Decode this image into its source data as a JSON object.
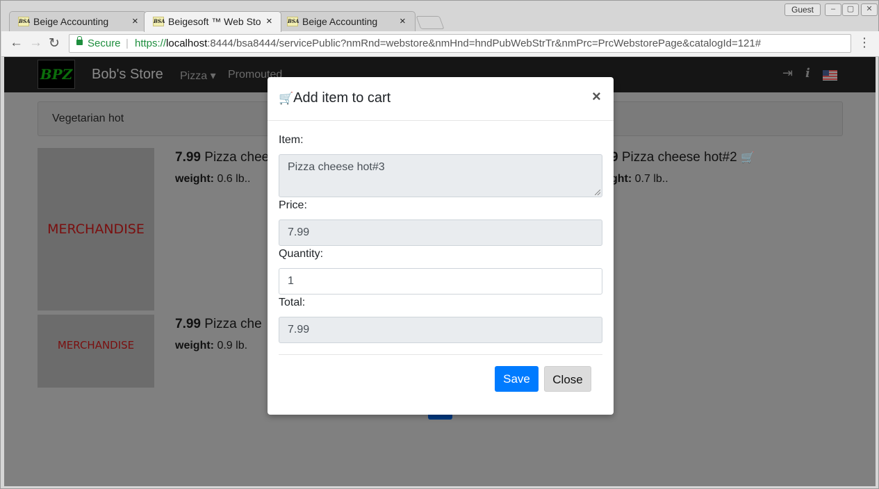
{
  "browser": {
    "tabs": [
      {
        "title": "Beige Accounting",
        "favicon": "BSA",
        "active": false
      },
      {
        "title": "Beigesoft ™ Web Sto",
        "favicon": "BSA",
        "active": true
      },
      {
        "title": "Beige Accounting",
        "favicon": "BSA",
        "active": false
      }
    ],
    "close_glyph": "×",
    "profile": "Guest",
    "window_controls": {
      "minimize": "–",
      "restore": "▢",
      "close": "✕"
    },
    "nav": {
      "back": "←",
      "forward": "→",
      "reload": "↻"
    },
    "address": {
      "secure_label": "Secure",
      "scheme": "https://",
      "host": "localhost",
      "rest": ":8444/bsa8444/servicePublic?nmRnd=webstore&nmHnd=hndPubWebStrTr&nmPrc=PrcWebstorePage&catalogId=121#"
    },
    "menu_glyph": "⋮"
  },
  "site": {
    "logo_text": "BPZ",
    "brand": "Bob's Store",
    "nav_items": [
      {
        "label": "Pizza ▾"
      },
      {
        "label": "Promouted"
      }
    ],
    "icons": {
      "login": "⇥",
      "info": "i"
    },
    "breadcrumb": "Vegetarian hot",
    "products": [
      {
        "price": "7.99",
        "name": "Pizza chee",
        "weight_label": "weight:",
        "weight": "0.6 lb..",
        "image_text": "MERCHANDISE"
      },
      {
        "price": "9",
        "name": "Pizza cheese hot#2",
        "weight_label": "ght:",
        "weight": "0.7 lb..",
        "cart_icon": "🛒"
      },
      {
        "price": "7.99",
        "name": "Pizza che",
        "weight_label": "weight:",
        "weight": "0.9 lb.",
        "image_text": "MERCHANDISE"
      }
    ]
  },
  "modal": {
    "title": "Add item to cart",
    "cart_glyph": "🛒",
    "close_glyph": "×",
    "item_label": "Item:",
    "item_value": "Pizza cheese hot#3",
    "price_label": "Price:",
    "price_value": "7.99",
    "quantity_label": "Quantity:",
    "quantity_value": "1",
    "total_label": "Total:",
    "total_value": "7.99",
    "save_label": "Save",
    "close_label": "Close"
  }
}
